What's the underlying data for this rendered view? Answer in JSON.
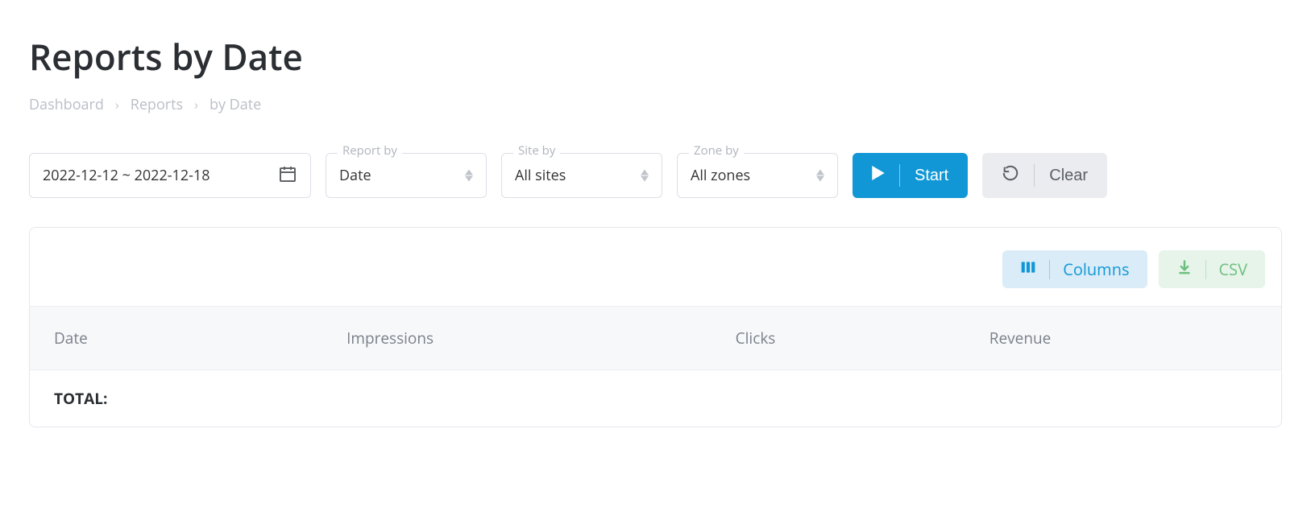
{
  "page": {
    "title": "Reports by Date"
  },
  "breadcrumb": {
    "dashboard": "Dashboard",
    "reports": "Reports",
    "current": "by Date"
  },
  "filters": {
    "date_range": "2022-12-12 ~ 2022-12-18",
    "report_by": {
      "label": "Report by",
      "value": "Date"
    },
    "site_by": {
      "label": "Site by",
      "value": "All sites"
    },
    "zone_by": {
      "label": "Zone by",
      "value": "All zones"
    }
  },
  "actions": {
    "start": "Start",
    "clear": "Clear"
  },
  "toolbar": {
    "columns": "Columns",
    "csv": "CSV"
  },
  "table": {
    "cols": {
      "date": "Date",
      "impressions": "Impressions",
      "clicks": "Clicks",
      "revenue": "Revenue"
    },
    "total_label": "TOTAL:"
  }
}
